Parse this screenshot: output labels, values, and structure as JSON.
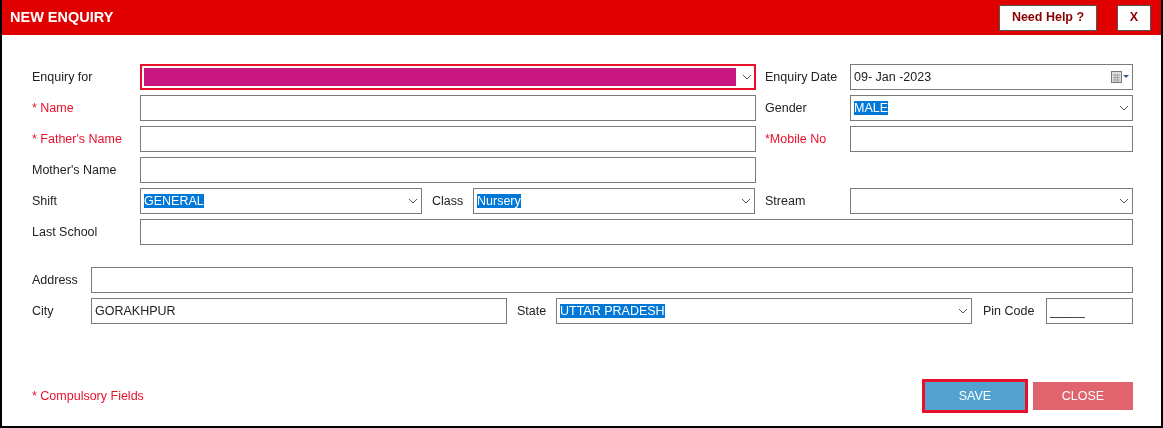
{
  "window": {
    "title": "NEW ENQUIRY",
    "help_button": "Need Help ?",
    "close_button": "X"
  },
  "rows": [
    [
      {
        "label": "Enquiry for",
        "required": false,
        "kind": "select",
        "focused": true
      },
      {
        "label": "Enquiry Date",
        "required": false,
        "kind": "date",
        "value": "09- Jan -2023",
        "focused": false
      }
    ],
    [
      {
        "label": "* Name",
        "required": true,
        "kind": "text",
        "focused": false
      },
      {
        "label": "Gender",
        "required": false,
        "kind": "select",
        "value": "MALE",
        "highlighted": true,
        "focused": false
      }
    ],
    [
      {
        "label": "* Father's Name",
        "required": true,
        "kind": "text",
        "focused": false
      },
      {
        "label": "*Mobile No",
        "required": true,
        "kind": "text",
        "focused": false
      }
    ],
    [
      {
        "label": "Mother's Name",
        "required": false,
        "kind": "text",
        "focused": false
      }
    ],
    [
      {
        "label": "Shift",
        "required": false,
        "kind": "select",
        "value": "GENERAL",
        "highlighted": true,
        "focused": false
      },
      {
        "label": "Class",
        "required": false,
        "kind": "select",
        "value": "Nursery",
        "highlighted": true,
        "focused": false
      },
      {
        "label": "Stream",
        "required": false,
        "kind": "select",
        "focused": false
      }
    ],
    [
      {
        "label": "Last School",
        "required": false,
        "kind": "text",
        "focused": false
      }
    ],
    [
      {
        "label": "Address",
        "required": false,
        "kind": "text",
        "focused": false
      }
    ],
    [
      {
        "label": "City",
        "required": false,
        "kind": "text",
        "value": "GORAKHPUR",
        "focused": false
      },
      {
        "label": "State",
        "required": false,
        "kind": "select",
        "value": "UTTAR PRADESH",
        "highlighted": true,
        "focused": false
      },
      {
        "label": "Pin Code",
        "required": false,
        "kind": "text",
        "value": "_____",
        "focused": false
      }
    ]
  ],
  "footer": {
    "note": "* Compulsory Fields",
    "buttons": [
      {
        "label": "SAVE",
        "kind": "save",
        "focused": true
      },
      {
        "label": "CLOSE",
        "kind": "close",
        "focused": false
      }
    ]
  }
}
